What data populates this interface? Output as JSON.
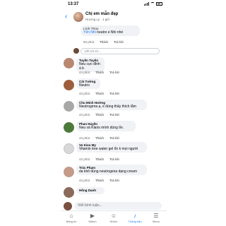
{
  "status": {
    "time": "13:37"
  },
  "header": {
    "title": "Chị em mẫn đẹp",
    "subtitle": "Hương Ly · 1 giờ ·"
  },
  "thread_reply": {
    "name": "Linh Thùy",
    "mention": "Yến Nhi",
    "text": " neutro e Nhi nhé",
    "time": "50 phút",
    "like": "Thích",
    "reply": "Trả lời"
  },
  "reply_input_placeholder": "Viết trả lời...",
  "comments": [
    {
      "name": "Tuyền Tuyền",
      "text": "Neu cực đỉnh á b",
      "time": "44 phút",
      "like": "Thích",
      "reply": "Trả lời"
    },
    {
      "name": "Cát Tường",
      "text": "Neutro",
      "time": "43 phút",
      "like": "Thích",
      "reply": "Trả lời"
    },
    {
      "name": "Chu Minh Hường",
      "text": "Neutrogena ạ, e dùng thấy thích lắm",
      "time": "43 phút",
      "like": "Thích",
      "reply": "Trả lời"
    },
    {
      "name": "Phan Huyền",
      "text": "Neu và Klairs mình dùng ổn.",
      "time": "43 phút",
      "like": "Thích",
      "reply": "Trả lời"
    },
    {
      "name": "Vo Kieu My",
      "text": "Vitamin tree water gel ổn k mọi người",
      "time": "43 phút",
      "like": "Thích",
      "reply": "Trả lời"
    },
    {
      "name": "Trúc Phạm",
      "text": "da khô dùng neutrogena dạng cream",
      "time": "43 phút",
      "like": "Thích",
      "reply": "Trả lời"
    },
    {
      "name": "Hồng Danh",
      "text": "",
      "time": "",
      "like": "",
      "reply": ""
    }
  ],
  "bottom_input_placeholder": "Viết bình luận...",
  "tabs": [
    {
      "label": "Bảng tin",
      "icon": "home-icon"
    },
    {
      "label": "Watch",
      "icon": "watch-icon"
    },
    {
      "label": "Nhóm",
      "icon": "groups-icon"
    },
    {
      "label": "Thông báo",
      "icon": "bell-icon"
    },
    {
      "label": "Menu",
      "icon": "menu-icon"
    }
  ],
  "colors": {
    "accent": "#1877f2",
    "bubble": "#f0f2f5",
    "muted": "#65676b"
  }
}
